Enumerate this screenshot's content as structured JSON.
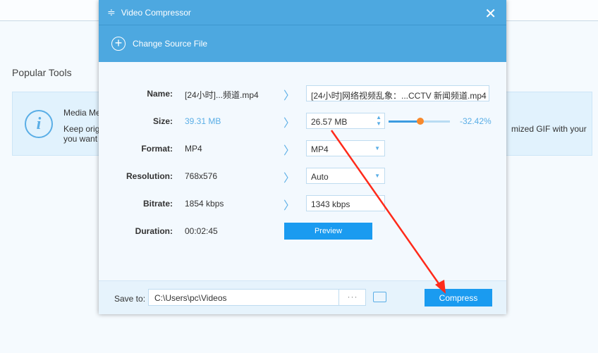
{
  "background": {
    "section_title": "Popular Tools",
    "card": {
      "title": "Media Met",
      "desc": "Keep origi",
      "desc2": "you want",
      "right_text": "mized GIF with your"
    }
  },
  "dialog": {
    "title": "Video Compressor",
    "change_source": "Change Source File",
    "rows": [
      {
        "label": "Name:",
        "original": "[24小时]...频道.mp4",
        "target": "[24小时]网络视频乱象：...CCTV 新闻频道.mp4"
      },
      {
        "label": "Size:",
        "original": "39.31 MB",
        "target": "26.57 MB",
        "percent": "-32.42%",
        "slider_value": 0.52
      },
      {
        "label": "Format:",
        "original": "MP4",
        "target": "MP4"
      },
      {
        "label": "Resolution:",
        "original": "768x576",
        "target": "Auto"
      },
      {
        "label": "Bitrate:",
        "original": "1854 kbps",
        "target": "1343 kbps"
      },
      {
        "label": "Duration:",
        "original": "00:02:45"
      }
    ],
    "preview_label": "Preview",
    "footer": {
      "save_to_label": "Save to:",
      "path": "C:\\Users\\pc\\Videos",
      "browse": "···",
      "compress_label": "Compress"
    }
  },
  "colors": {
    "accent": "#4da8e0",
    "button": "#1a9bf0",
    "annotation": "#ff2a1a"
  }
}
